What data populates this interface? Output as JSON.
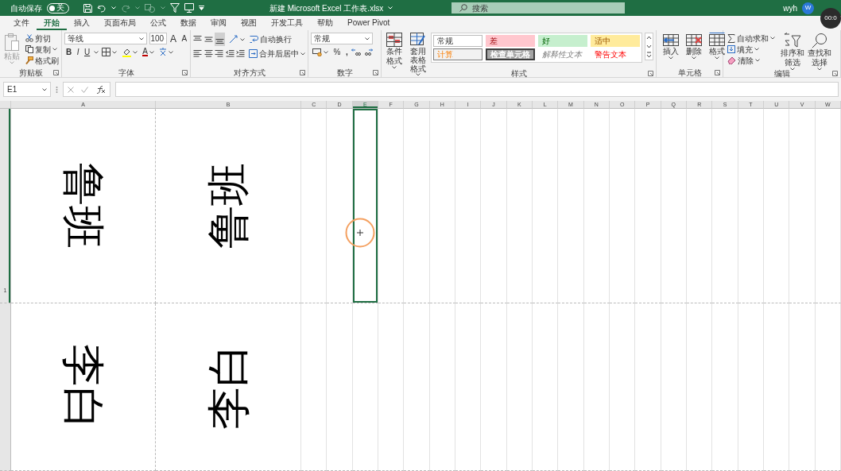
{
  "title_bar": {
    "autosave_label": "自动保存",
    "autosave": {
      "on": false,
      "label": "关"
    },
    "title": "新建 Microsoft Excel 工作表.xlsx",
    "search": {
      "placeholder": "搜索"
    },
    "user": "wyh",
    "avatar": "W"
  },
  "recording_timer": "00:0",
  "tabs": [
    {
      "label": "文件",
      "selected": false
    },
    {
      "label": "开始",
      "selected": true
    },
    {
      "label": "插入",
      "selected": false
    },
    {
      "label": "页面布局",
      "selected": false
    },
    {
      "label": "公式",
      "selected": false
    },
    {
      "label": "数据",
      "selected": false
    },
    {
      "label": "审阅",
      "selected": false
    },
    {
      "label": "视图",
      "selected": false
    },
    {
      "label": "开发工具",
      "selected": false
    },
    {
      "label": "帮助",
      "selected": false
    },
    {
      "label": "Power Pivot",
      "selected": false
    }
  ],
  "ribbon": {
    "clipboard": {
      "label": "剪贴板",
      "paste": {
        "label": "粘贴",
        "disabled": true
      },
      "cut": "剪切",
      "copy": "复制",
      "format_painter": "格式刷"
    },
    "font": {
      "label": "字体",
      "font_name": "等线",
      "font_size": "100",
      "grow": "A",
      "shrink": "A",
      "bold": "B",
      "italic": "I",
      "underline": "U",
      "font_color": "A"
    },
    "alignment": {
      "label": "对齐方式",
      "wrap_text": "自动换行",
      "merge_center": "合并后居中"
    },
    "number": {
      "label": "数字",
      "format": "常规",
      "percent": "%",
      "comma": ","
    },
    "styles": {
      "label": "样式",
      "conditional_format": "条件格式",
      "format_as_table": [
        "套用",
        "表格格式"
      ],
      "gallery": [
        {
          "label": "常规",
          "kind": "normal"
        },
        {
          "label": "差",
          "kind": "bad"
        },
        {
          "label": "好",
          "kind": "good"
        },
        {
          "label": "适中",
          "kind": "neutral"
        },
        {
          "label": "计算",
          "kind": "calculation"
        },
        {
          "label": "检查单元格",
          "kind": "check"
        },
        {
          "label": "解释性文本",
          "kind": "explanatory"
        },
        {
          "label": "警告文本",
          "kind": "warning"
        }
      ]
    },
    "cells": {
      "label": "单元格",
      "insert": "插入",
      "delete": "删除",
      "format": "格式"
    },
    "editing": {
      "label": "编辑",
      "autosum": "自动求和",
      "fill": "填充",
      "clear": "清除",
      "sort_filter": "排序和筛选",
      "find_select": "查找和选择"
    }
  },
  "formula_bar": {
    "name_box": "E1"
  },
  "sheet": {
    "columns": [
      {
        "label": "A",
        "selected": false
      },
      {
        "label": "B",
        "selected": false
      },
      {
        "label": "C",
        "selected": false
      },
      {
        "label": "D",
        "selected": false
      },
      {
        "label": "E",
        "selected": true
      },
      {
        "label": "F",
        "selected": false
      },
      {
        "label": "G",
        "selected": false
      },
      {
        "label": "H",
        "selected": false
      },
      {
        "label": "I",
        "selected": false
      },
      {
        "label": "J",
        "selected": false
      },
      {
        "label": "K",
        "selected": false
      },
      {
        "label": "L",
        "selected": false
      },
      {
        "label": "M",
        "selected": false
      },
      {
        "label": "N",
        "selected": false
      },
      {
        "label": "O",
        "selected": false
      },
      {
        "label": "P",
        "selected": false
      },
      {
        "label": "Q",
        "selected": false
      },
      {
        "label": "R",
        "selected": false
      },
      {
        "label": "S",
        "selected": false
      },
      {
        "label": "T",
        "selected": false
      },
      {
        "label": "U",
        "selected": false
      },
      {
        "label": "V",
        "selected": false
      },
      {
        "label": "W",
        "selected": false
      }
    ],
    "rows": [
      {
        "label": "1",
        "selected": true,
        "cells": [
          {
            "text": "鲁班",
            "rotated_clockwise": true
          },
          {
            "text": "鲁班",
            "rotated_clockwise": false
          }
        ]
      },
      {
        "selected": false,
        "cells": [
          {
            "text": "李白",
            "rotated_clockwise": true
          },
          {
            "text": "李白",
            "rotated_clockwise": false
          }
        ]
      }
    ]
  }
}
